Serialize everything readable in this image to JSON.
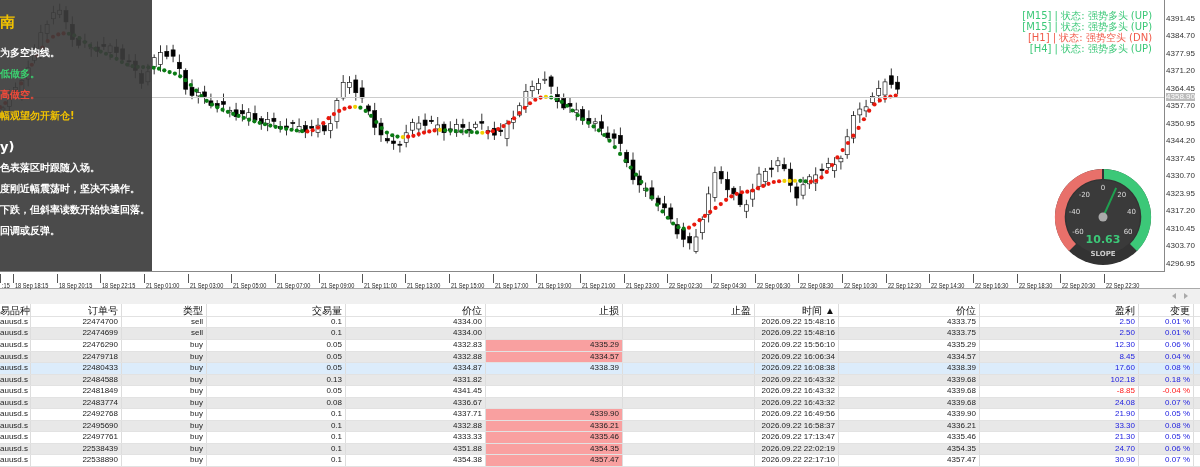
{
  "guide_panel": {
    "lines": [
      {
        "kind": "title",
        "text": "南",
        "color": "#f2c200"
      },
      {
        "kind": "text",
        "text": "为多空均线。",
        "color": "#ffffff"
      },
      {
        "kind": "text",
        "text": "低做多。",
        "color": "#3cd070"
      },
      {
        "kind": "text",
        "text": "高做空。",
        "color": "#f04a3a"
      },
      {
        "kind": "text",
        "text": "幅观望勿开新仓!",
        "color": "#f2c200"
      },
      {
        "kind": "heading",
        "text": "y)",
        "color": "#ffffff"
      },
      {
        "kind": "text",
        "text": "色表落区时跟随入场。",
        "color": "#ffffff"
      },
      {
        "kind": "text",
        "text": "度刚近幅震荡时，坚决不操作。",
        "color": "#ffffff"
      },
      {
        "kind": "text",
        "text": "下跌，但斜率读数开始快速回落。",
        "color": "#ffffff"
      },
      {
        "kind": "text",
        "text": "回调或反弹。",
        "color": "#ffffff"
      }
    ]
  },
  "trend_signals": [
    {
      "text": "[M15] | 状态: 强势多头 (UP)",
      "color": "#3cc878"
    },
    {
      "text": "[M15] | 状态: 强势多头 (UP)",
      "color": "#3cc878"
    },
    {
      "text": "[H1] | 状态: 强势空头 (DN)",
      "color": "#f05a4a"
    },
    {
      "text": "[H4] | 状态: 强势多头 (UP)",
      "color": "#3cc878"
    }
  ],
  "price_axis": [
    "4391.45",
    "4384.70",
    "4377.95",
    "4371.20",
    "4364.45",
    "4357.70",
    "4350.95",
    "4344.20",
    "4337.45",
    "4330.70",
    "4323.95",
    "4317.20",
    "4310.45",
    "4303.70",
    "4296.95"
  ],
  "current_price": "4358.90",
  "time_axis": [
    ":15",
    "18 Sep 18:15",
    "18 Sep 20:15",
    "18 Sep 22:15",
    "21 Sep 01:00",
    "21 Sep 03:00",
    "21 Sep 05:00",
    "21 Sep 07:00",
    "21 Sep 09:00",
    "21 Sep 11:00",
    "21 Sep 13:00",
    "21 Sep 15:00",
    "21 Sep 17:00",
    "21 Sep 19:00",
    "21 Sep 21:00",
    "21 Sep 23:00",
    "22 Sep 02:30",
    "22 Sep 04:30",
    "22 Sep 06:30",
    "22 Sep 08:30",
    "22 Sep 10:30",
    "22 Sep 12:30",
    "22 Sep 14:30",
    "22 Sep 16:30",
    "22 Sep 18:30",
    "22 Sep 20:30",
    "22 Sep 22:30"
  ],
  "gauge": {
    "ticks": [
      "-60",
      "-40",
      "-20",
      "0",
      "20",
      "40",
      "60"
    ],
    "value": "10.63",
    "label": "SLOPE",
    "level": 0.59
  },
  "table": {
    "columns": [
      "易品种",
      "订单号",
      "类型",
      "交易量",
      "价位",
      "止损",
      "止盈",
      "时间 ▲",
      "价位",
      "盈利",
      "变更"
    ],
    "rows": [
      {
        "cells": [
          "auusd.s",
          "22474700",
          "sell",
          "0.1",
          "4334.00",
          "",
          "",
          "2026.09.22 15:48:16",
          "4333.75",
          "2.50",
          "0.01 %"
        ],
        "selected": false,
        "sl_alert": false,
        "negative": false
      },
      {
        "cells": [
          "auusd.s",
          "22474699",
          "sell",
          "0.1",
          "4334.00",
          "",
          "",
          "2026.09.22 15:48:16",
          "4333.75",
          "2.50",
          "0.01 %"
        ],
        "selected": false,
        "sl_alert": false,
        "negative": false
      },
      {
        "cells": [
          "auusd.s",
          "22476290",
          "buy",
          "0.05",
          "4332.83",
          "4335.29",
          "",
          "2026.09.22 15:56:10",
          "4335.29",
          "12.30",
          "0.06 %"
        ],
        "selected": false,
        "sl_alert": true,
        "negative": false
      },
      {
        "cells": [
          "auusd.s",
          "22479718",
          "buy",
          "0.05",
          "4332.88",
          "4334.57",
          "",
          "2026.09.22 16:06:34",
          "4334.57",
          "8.45",
          "0.04 %"
        ],
        "selected": false,
        "sl_alert": true,
        "negative": false
      },
      {
        "cells": [
          "auusd.s",
          "22480433",
          "buy",
          "0.05",
          "4334.87",
          "4338.39",
          "",
          "2026.09.22 16:08:38",
          "4338.39",
          "17.60",
          "0.08 %"
        ],
        "selected": true,
        "sl_alert": false,
        "negative": false
      },
      {
        "cells": [
          "auusd.s",
          "22484588",
          "buy",
          "0.13",
          "4331.82",
          "",
          "",
          "2026.09.22 16:43:32",
          "4339.68",
          "102.18",
          "0.18 %"
        ],
        "selected": false,
        "sl_alert": false,
        "negative": false
      },
      {
        "cells": [
          "auusd.s",
          "22481849",
          "buy",
          "0.05",
          "4341.45",
          "",
          "",
          "2026.09.22 16:43:32",
          "4339.68",
          "-8.85",
          "-0.04 %"
        ],
        "selected": false,
        "sl_alert": false,
        "negative": true
      },
      {
        "cells": [
          "auusd.s",
          "22483774",
          "buy",
          "0.08",
          "4336.67",
          "",
          "",
          "2026.09.22 16:43:32",
          "4339.68",
          "24.08",
          "0.07 %"
        ],
        "selected": false,
        "sl_alert": false,
        "negative": false
      },
      {
        "cells": [
          "auusd.s",
          "22492768",
          "buy",
          "0.1",
          "4337.71",
          "4339.90",
          "",
          "2026.09.22 16:49:56",
          "4339.90",
          "21.90",
          "0.05 %"
        ],
        "selected": false,
        "sl_alert": true,
        "negative": false
      },
      {
        "cells": [
          "auusd.s",
          "22495690",
          "buy",
          "0.1",
          "4332.88",
          "4336.21",
          "",
          "2026.09.22 16:58:37",
          "4336.21",
          "33.30",
          "0.08 %"
        ],
        "selected": false,
        "sl_alert": true,
        "negative": false
      },
      {
        "cells": [
          "auusd.s",
          "22497761",
          "buy",
          "0.1",
          "4333.33",
          "4335.46",
          "",
          "2026.09.22 17:13:47",
          "4335.46",
          "21.30",
          "0.05 %"
        ],
        "selected": false,
        "sl_alert": true,
        "negative": false
      },
      {
        "cells": [
          "auusd.s",
          "22538439",
          "buy",
          "0.1",
          "4351.88",
          "4354.35",
          "",
          "2026.09.22 22:02:19",
          "4354.35",
          "24.70",
          "0.06 %"
        ],
        "selected": false,
        "sl_alert": true,
        "negative": false
      },
      {
        "cells": [
          "auusd.s",
          "22538890",
          "buy",
          "0.1",
          "4354.38",
          "4357.47",
          "",
          "2026.09.22 22:17:10",
          "4357.47",
          "30.90",
          "0.07 %"
        ],
        "selected": false,
        "sl_alert": true,
        "negative": false
      }
    ]
  }
}
